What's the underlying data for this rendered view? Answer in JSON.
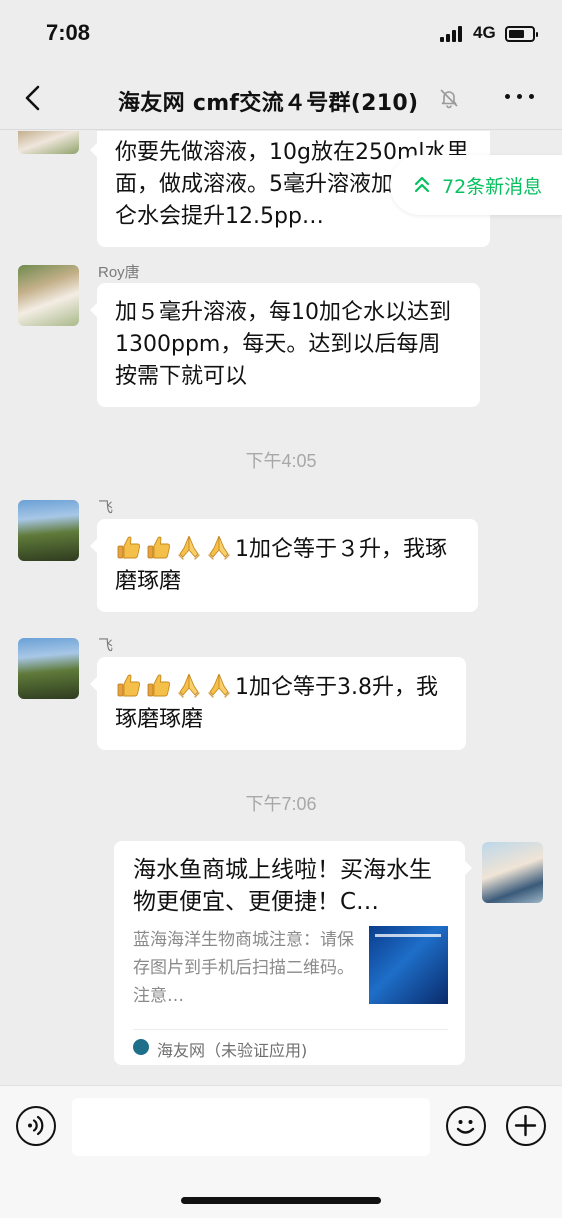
{
  "status_bar": {
    "time": "7:08",
    "network": "4G",
    "battery_level": 0.7
  },
  "nav": {
    "title": "海友网 cmf交流４号群(210)"
  },
  "new_messages": {
    "label": "72条新消息"
  },
  "messages": [
    {
      "text": "你要先做溶液，10g放在250ml水里面，做成溶液。5毫升溶液加到1加仑水会提升12.5pp…"
    },
    {
      "sender": "Roy唐",
      "text": "加５毫升溶液，每10加仑水以达到1300ppm，每天。达到以后每周按需下就可以"
    },
    {
      "time": "下午4:05"
    },
    {
      "sender": "飞",
      "emoji": [
        "thumbs-up",
        "thumbs-up",
        "praying-hands",
        "praying-hands"
      ],
      "text": "1加仑等于３升，我琢磨琢磨"
    },
    {
      "sender": "飞",
      "emoji": [
        "thumbs-up",
        "thumbs-up",
        "praying-hands",
        "praying-hands"
      ],
      "text": "1加仑等于3.8升，我琢磨琢磨"
    },
    {
      "time": "下午7:06"
    },
    {
      "card": {
        "title": "海水鱼商城上线啦！买海水生物更便宜、更便捷！C…",
        "description": "蓝海海洋生物商城注意：请保存图片到手机后扫描二维码。注意…",
        "source": "海友网（未验证应用)"
      }
    }
  ],
  "input": {
    "placeholder": ""
  },
  "icons": {
    "back": "chevron-left-icon",
    "mute": "bell-off-icon",
    "more": "more-icon",
    "voice": "voice-icon",
    "emoji": "smiley-icon",
    "plus": "plus-icon"
  },
  "colors": {
    "accent": "#07c160",
    "background": "#ededed",
    "bubble": "#ffffff"
  }
}
